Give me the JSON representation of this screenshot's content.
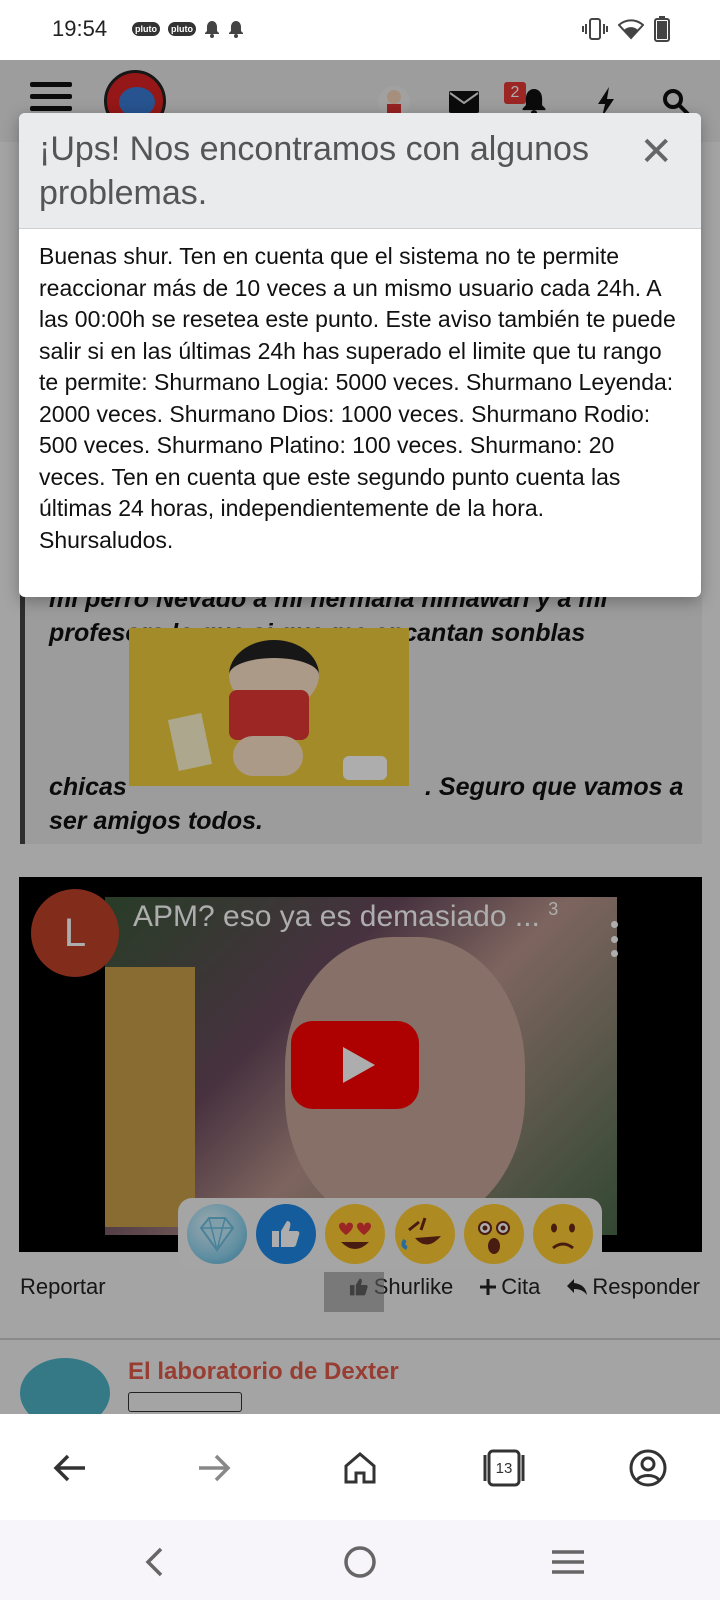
{
  "status_bar": {
    "time": "19:54",
    "notif_icons": [
      "pluto-tv-icon",
      "pluto-tv-icon",
      "bell-icon",
      "bell-icon"
    ],
    "pluto_label": "pluto",
    "right_icons": [
      "vibrate-icon",
      "wifi-icon",
      "battery-icon"
    ]
  },
  "header": {
    "notification_count": "2"
  },
  "modal": {
    "title": "¡Ups! Nos encontramos con algunos problemas.",
    "close_symbol": "✕",
    "message": "Buenas shur. Ten en cuenta que el sistema no te permite reaccionar más de 10 veces a un mismo usuario cada 24h. A las 00:00h se resetea este punto. Este aviso también te puede salir si en las últimas 24h has superado el limite que tu rango te permite: Shurmano Logia: 5000 veces. Shurmano Leyenda: 2000 veces. Shurmano Dios: 1000 veces. Shurmano Rodio: 500 veces. Shurmano Platino: 100 veces. Shurmano: 20 veces. Ten en cuenta que este segundo punto cuenta las últimas 24 horas, independientemente de la hora. Shursaludos."
  },
  "post": {
    "quote_line1": "mi perro Nevado a mi hermana himawari y a mi",
    "quote_line2": "profesora lo que si que me encantan sonblas",
    "quote_line3": "chicas",
    "quote_line4": ". Seguro que vamos a",
    "quote_line5": "ser amigos todos."
  },
  "video": {
    "channel_initial": "L",
    "title": "APM? eso ya es demasiado ...",
    "corner_number": "3"
  },
  "reactions": [
    "diamond-icon",
    "like-icon",
    "heart-eyes-icon",
    "rofl-icon",
    "astonished-icon",
    "slightly-frowning-icon"
  ],
  "actions": {
    "report": "Reportar",
    "like": "Shurlike",
    "quote": "Cita",
    "reply": "Responder"
  },
  "next_post": {
    "username": "El laboratorio de Dexter"
  },
  "browser": {
    "tabs_count": "13"
  }
}
